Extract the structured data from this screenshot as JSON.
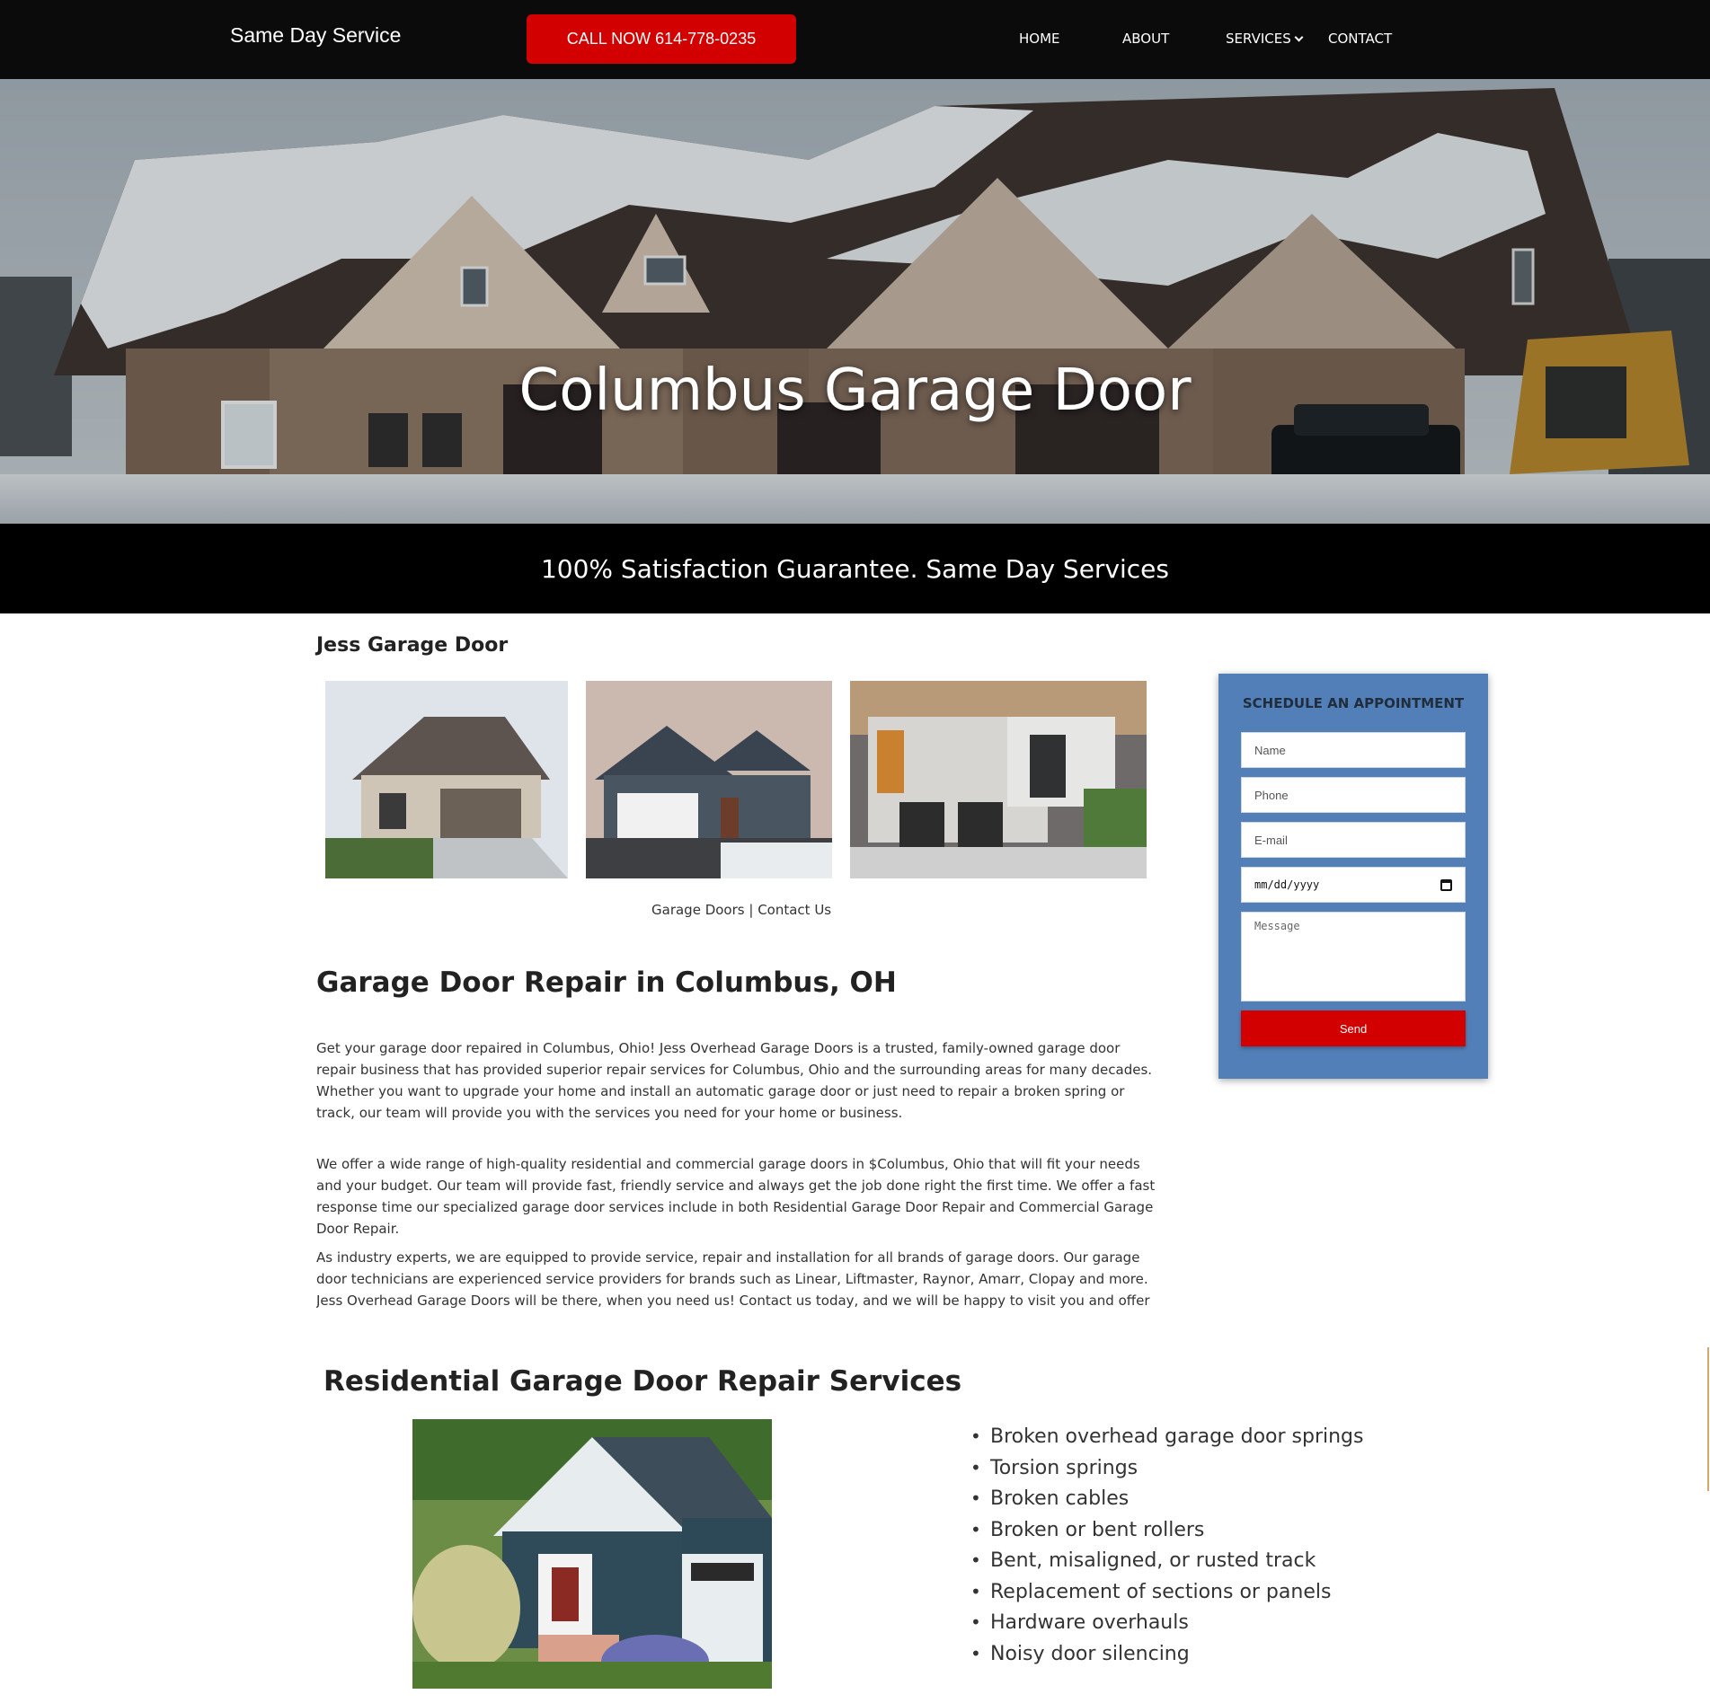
{
  "header": {
    "brand": "Same Day Service",
    "call_button": "CALL NOW 614-778-0235",
    "nav": {
      "home": "HOME",
      "about": "ABOUT",
      "services": "SERVICES",
      "contact": "CONTACT"
    }
  },
  "hero": {
    "title": "Columbus Garage Door"
  },
  "banner": {
    "text": "100% Satisfaction Guarantee. Same Day Services"
  },
  "main": {
    "subtitle": "Jess Garage Door",
    "links": {
      "garage_doors": "Garage Doors",
      "separator": " | ",
      "contact_us": "Contact Us"
    },
    "heading": "Garage Door Repair in Columbus, OH",
    "paragraphs": [
      "Get your garage door repaired in Columbus, Ohio! Jess Overhead Garage Doors is a trusted, family-owned garage door repair business that has provided superior repair services for Columbus, Ohio and the surrounding areas for many decades. Whether you want to upgrade your home and install an automatic garage door or just need to repair a broken spring or track, our team will provide you with the services you need for your home or business.",
      "We offer a wide range of high-quality residential and commercial garage doors in $Columbus, Ohio that will fit your needs and your budget. Our team will provide fast, friendly service and always get the job done right the first time. We offer a fast response time our specialized garage door services include in both Residential Garage Door Repair and Commercial Garage Door Repair.",
      "As industry experts, we are equipped to provide service, repair and installation for all brands of garage doors. Our garage door technicians are experienced service providers for brands such as Linear, Liftmaster, Raynor, Amarr, Clopay and more. Jess Overhead Garage Doors will be there, when you need us! Contact us today, and we will be happy to visit you and offer an estimate for your"
    ],
    "residential": {
      "heading": "Residential Garage Door Repair Services",
      "items": [
        "Broken overhead garage door springs",
        "Torsion springs",
        "Broken cables",
        "Broken or bent rollers",
        "Bent, misaligned, or rusted track",
        "Replacement of sections or panels",
        "Hardware overhauls",
        "Noisy door silencing"
      ]
    }
  },
  "form": {
    "title": "SCHEDULE AN APPOINTMENT",
    "name_placeholder": "Name",
    "phone_placeholder": "Phone",
    "email_placeholder": "E-mail",
    "date_placeholder": "mm/dd/yyyy",
    "message_placeholder": "Message",
    "send_label": "Send"
  },
  "colors": {
    "header_bg": "#0b0b0b",
    "accent_red": "#d30000",
    "form_blue": "#537fb8",
    "banner_bg": "#000000"
  },
  "icons": {
    "services_dropdown": "chevron-down-icon",
    "date_picker": "calendar-icon"
  }
}
